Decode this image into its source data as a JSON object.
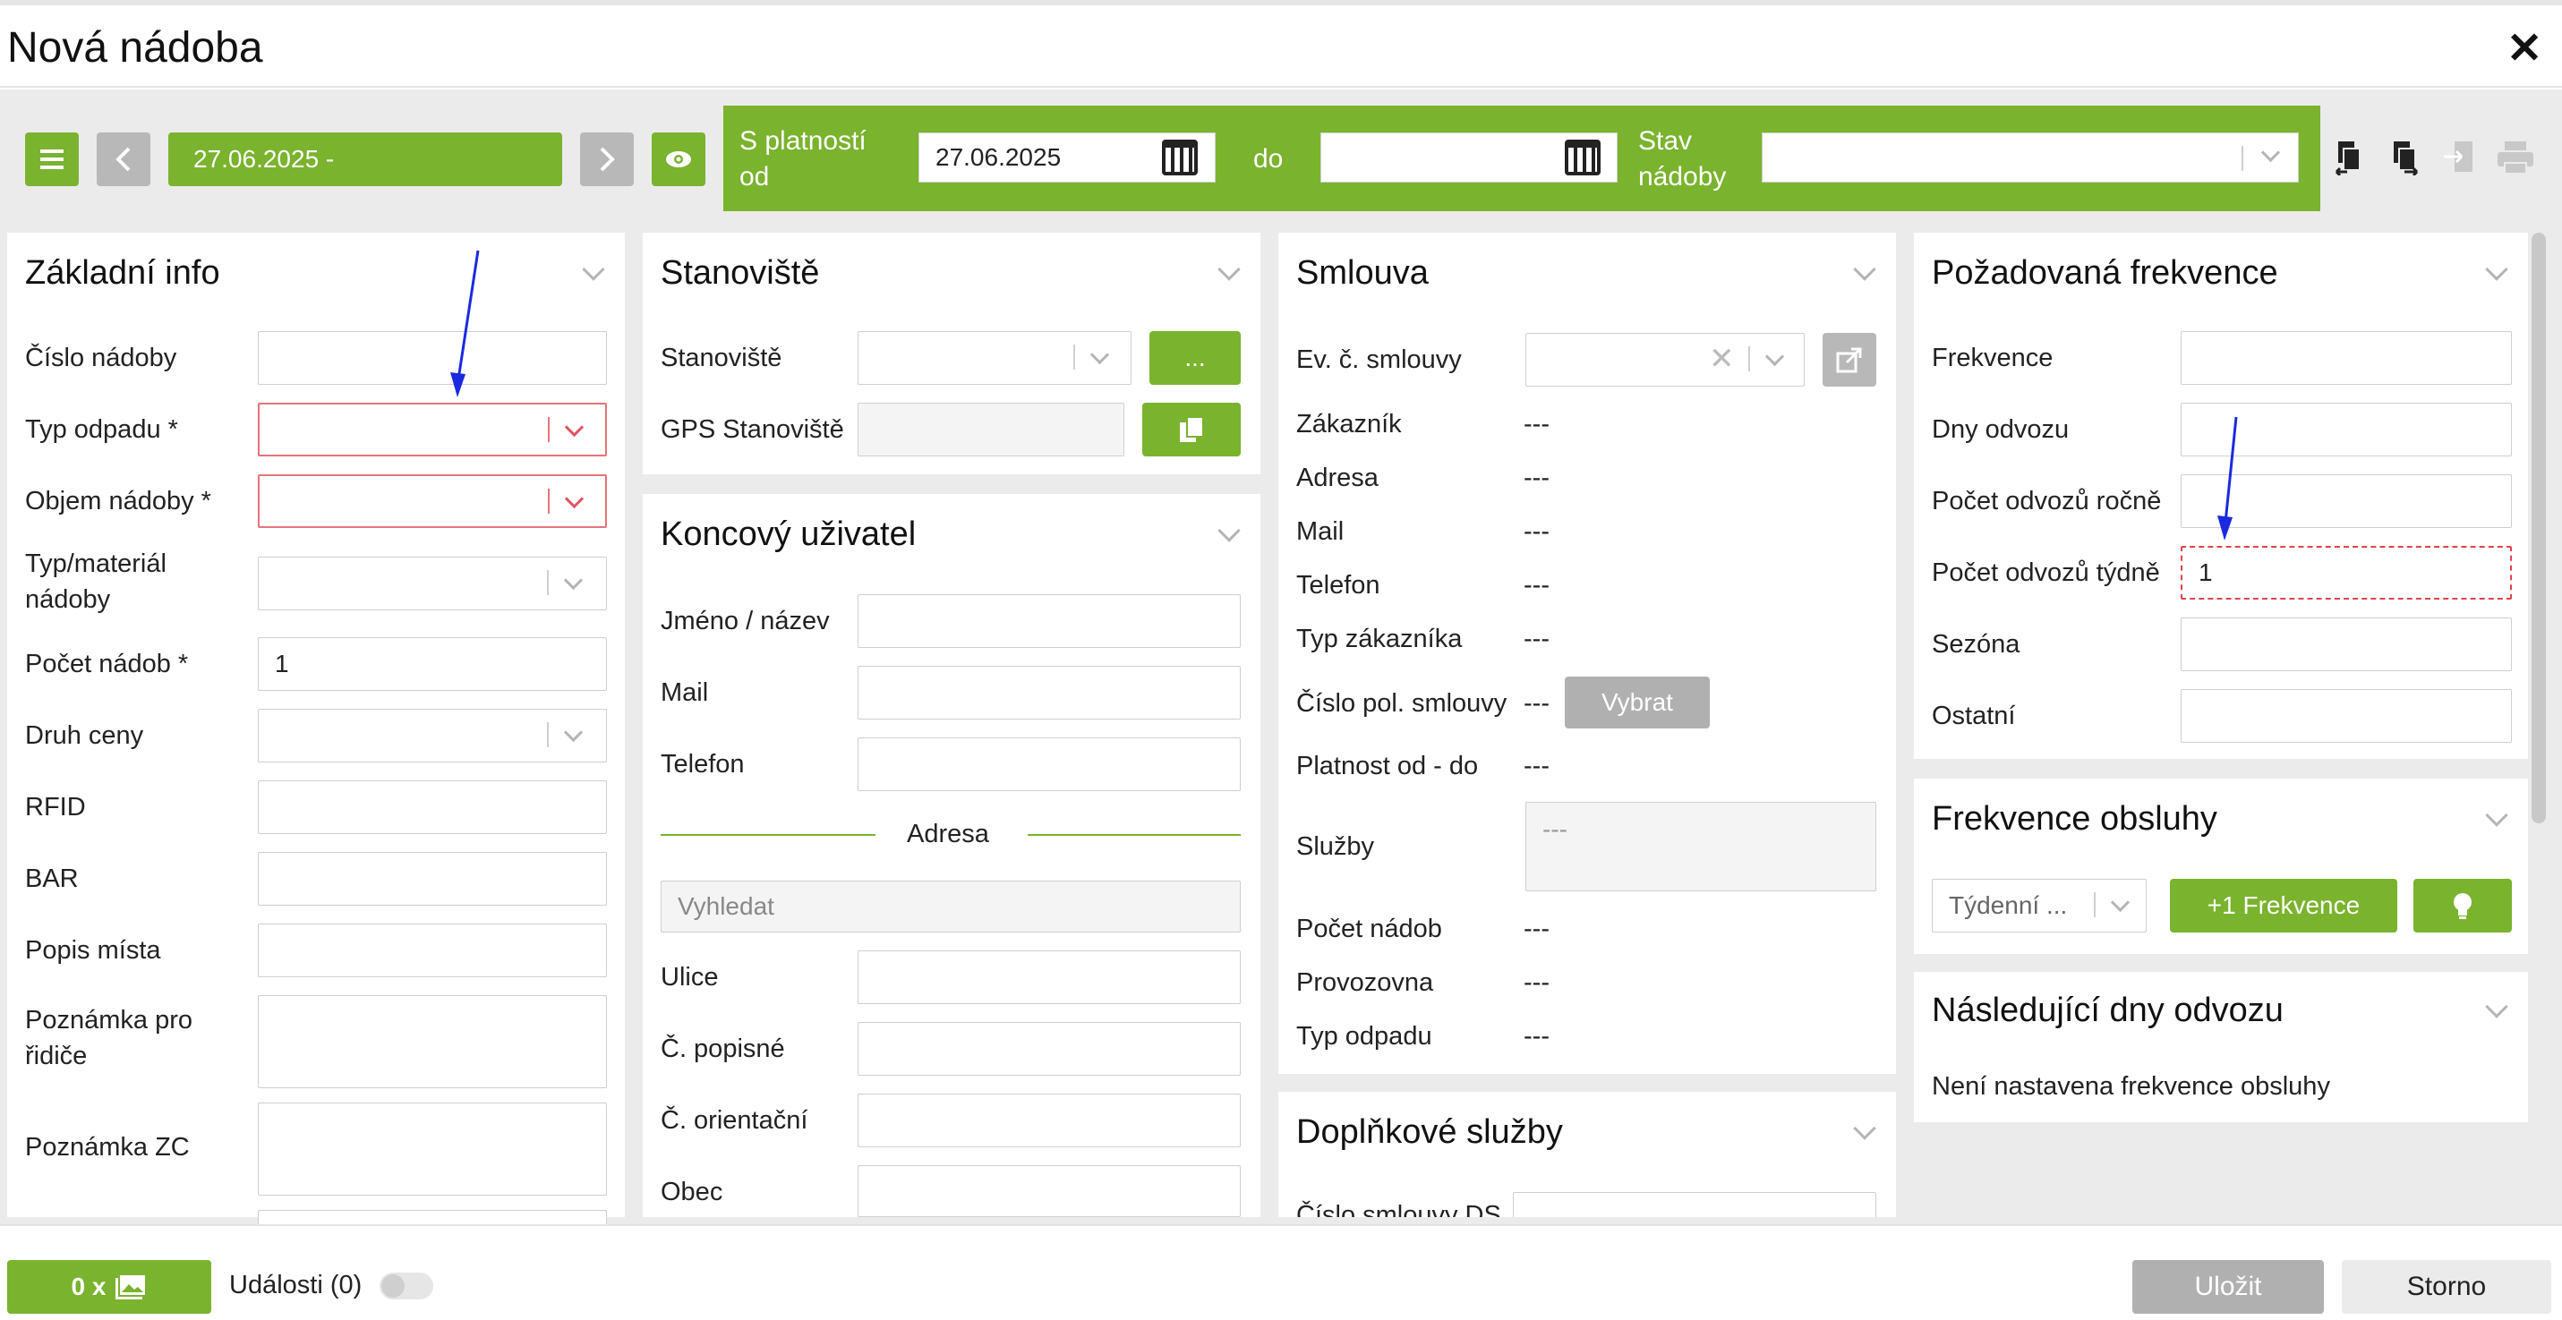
{
  "dialog": {
    "title": "Nová nádoba",
    "close": "✕"
  },
  "toolbar": {
    "date_range": "27.06.2025 -",
    "valid_from_label": "S platností od",
    "valid_from_value": "27.06.2025",
    "to_label": "do",
    "valid_to_value": "",
    "state_label": "Stav nádoby",
    "state_value": ""
  },
  "zakladni_info": {
    "title": "Základní info",
    "fields": [
      {
        "label": "Číslo nádoby",
        "value": ""
      },
      {
        "label": "Typ odpadu *",
        "value": ""
      },
      {
        "label": "Objem nádoby *",
        "value": ""
      },
      {
        "label": "Typ/materiál nádoby",
        "value": ""
      },
      {
        "label": "Počet nádob *",
        "value": "1"
      },
      {
        "label": "Druh ceny",
        "value": ""
      },
      {
        "label": "RFID",
        "value": ""
      },
      {
        "label": "BAR",
        "value": ""
      },
      {
        "label": "Popis místa",
        "value": ""
      },
      {
        "label": "Poznámka pro řidiče",
        "value": ""
      },
      {
        "label": "Poznámka ZC",
        "value": ""
      }
    ]
  },
  "stanoviste": {
    "title": "Stanoviště",
    "stanoviste_label": "Stanoviště",
    "gps_label": "GPS Stanoviště",
    "more_button": "..."
  },
  "koncovy_uzivatel": {
    "title": "Koncový uživatel",
    "jmeno_label": "Jméno / název",
    "mail_label": "Mail",
    "telefon_label": "Telefon",
    "adresa_divider": "Adresa",
    "search_placeholder": "Vyhledat",
    "ulice_label": "Ulice",
    "popisne_label": "Č. popisné",
    "orientacni_label": "Č. orientační",
    "obec_label": "Obec"
  },
  "smlouva": {
    "title": "Smlouva",
    "ev_label": "Ev. č. smlouvy",
    "rows": [
      {
        "label": "Zákazník",
        "value": "---"
      },
      {
        "label": "Adresa",
        "value": "---"
      },
      {
        "label": "Mail",
        "value": "---"
      },
      {
        "label": "Telefon",
        "value": "---"
      },
      {
        "label": "Typ zákazníka",
        "value": "---"
      }
    ],
    "cislo_pol_label": "Číslo pol. smlouvy",
    "cislo_pol_value": "---",
    "vybrat_button": "Vybrat",
    "platnost_label": "Platnost od - do",
    "platnost_value": "---",
    "sluzby_label": "Služby",
    "sluzby_value": "---",
    "rows2": [
      {
        "label": "Počet nádob",
        "value": "---"
      },
      {
        "label": "Provozovna",
        "value": "---"
      },
      {
        "label": "Typ odpadu",
        "value": "---"
      }
    ]
  },
  "doplnkove": {
    "title": "Doplňkové služby",
    "cislo_label": "Číslo smlouvy DS"
  },
  "pozadovana": {
    "title": "Požadovaná frekvence",
    "fields": [
      {
        "label": "Frekvence",
        "value": ""
      },
      {
        "label": "Dny odvozu",
        "value": ""
      },
      {
        "label": "Počet odvozů ročně",
        "value": ""
      },
      {
        "label": "Počet odvozů týdně",
        "value": "1"
      },
      {
        "label": "Sezóna",
        "value": ""
      },
      {
        "label": "Ostatní",
        "value": ""
      }
    ]
  },
  "frekvence_obsluhy": {
    "title": "Frekvence obsluhy",
    "select_value": "Týdenní ...",
    "add_button": "+1 Frekvence"
  },
  "nasledujici": {
    "title": "Následující dny odvozu",
    "message": "Není nastavena frekvence obsluhy"
  },
  "footer": {
    "photos_button": "0 x",
    "events_label": "Události (0)",
    "save_button": "Uložit",
    "cancel_button": "Storno"
  },
  "colors": {
    "accent": "#7ab32e",
    "error": "#e8737a",
    "annotation": "#1a2ae0"
  }
}
